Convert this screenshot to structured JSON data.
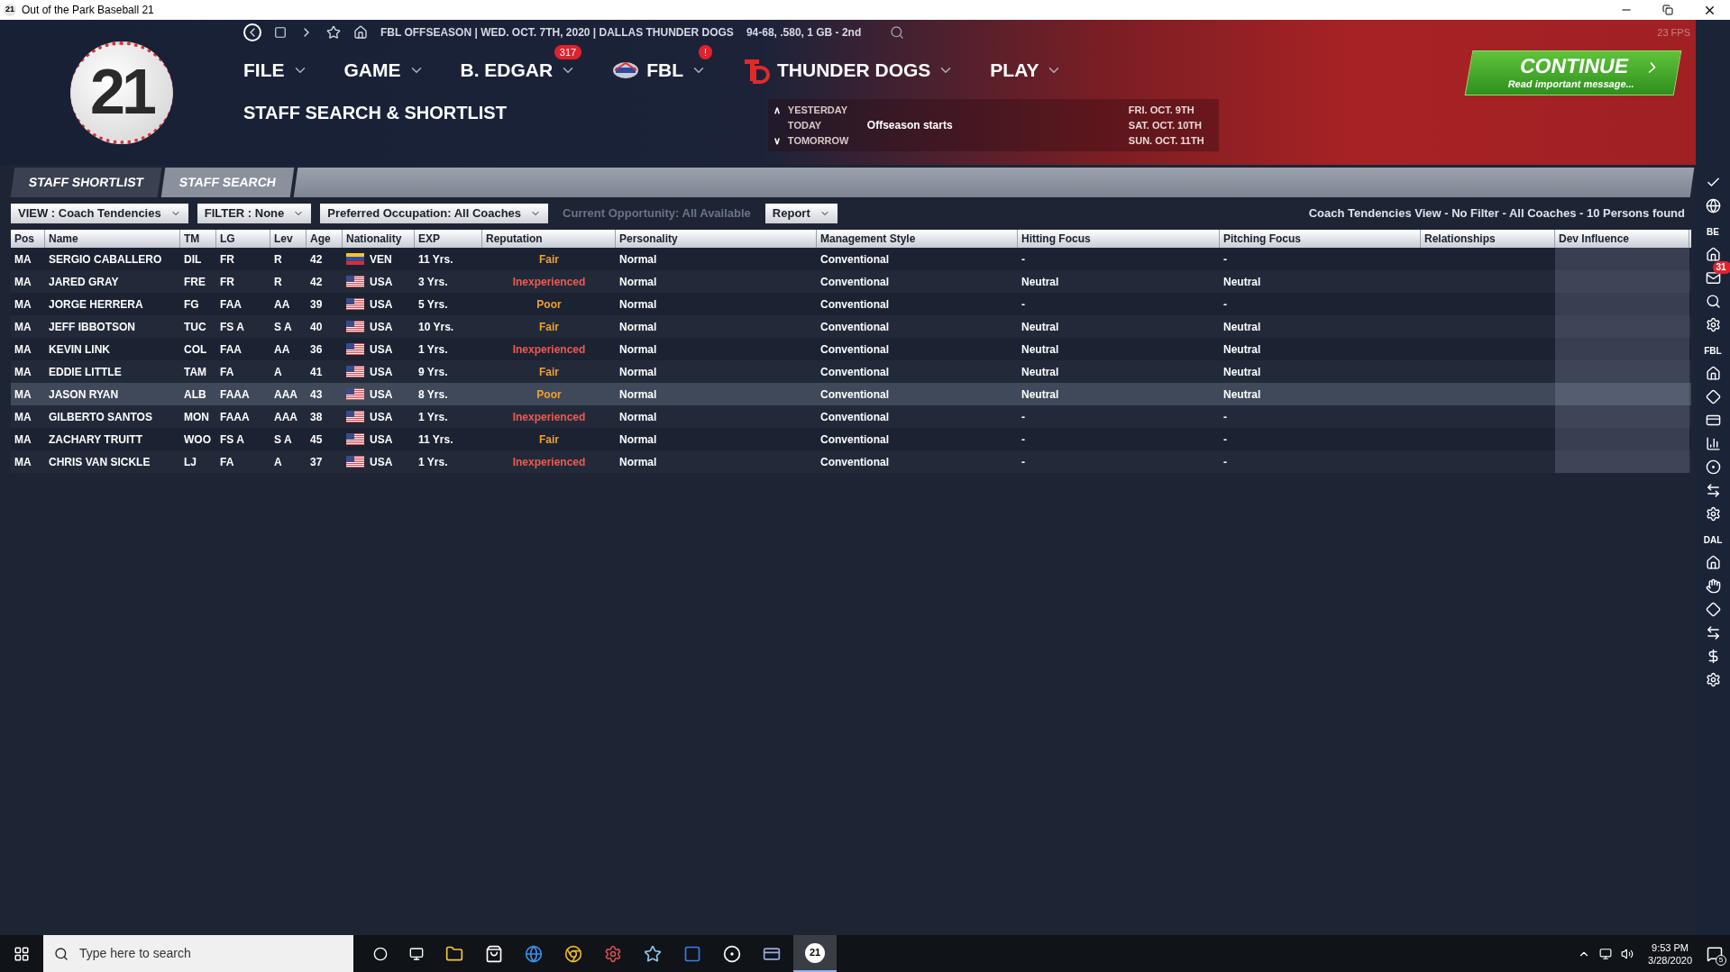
{
  "window": {
    "title": "Out of the Park Baseball 21",
    "app_icon": "21",
    "fps": "23 FPS"
  },
  "logo": {
    "text": "21"
  },
  "status": {
    "text": "FBL OFFSEASON | WED. OCT. 7TH, 2020 | DALLAS THUNDER DOGS",
    "record": "94-68, .580, 1 GB - 2nd"
  },
  "menus": [
    {
      "label": "FILE",
      "kind": "plain"
    },
    {
      "label": "GAME",
      "kind": "plain"
    },
    {
      "label": "B. EDGAR",
      "kind": "plain",
      "badge": "317"
    },
    {
      "label": "FBL",
      "kind": "league",
      "badge": "!"
    },
    {
      "label": "THUNDER DOGS",
      "kind": "team"
    },
    {
      "label": "PLAY",
      "kind": "plain"
    }
  ],
  "page_title": "STAFF SEARCH & SHORTLIST",
  "calendar": {
    "days": [
      {
        "arrow": "∧",
        "label": "YESTERDAY"
      },
      {
        "label": "TODAY",
        "event": "Offseason starts"
      },
      {
        "arrow": "∨",
        "label": "TOMORROW"
      }
    ],
    "upcoming": [
      "FRI. OCT. 9TH",
      "SAT. OCT. 10TH",
      "SUN. OCT. 11TH"
    ]
  },
  "continue": {
    "label": "CONTINUE",
    "sublabel": "Read important message..."
  },
  "tabs": [
    {
      "label": "STAFF SHORTLIST",
      "selected": false
    },
    {
      "label": "STAFF SEARCH",
      "selected": true
    }
  ],
  "toolbar": {
    "dropdowns": [
      {
        "label": "VIEW : Coach Tendencies",
        "disabled": false
      },
      {
        "label": "FILTER : None",
        "disabled": false
      },
      {
        "label": "Preferred Occupation: All Coaches",
        "disabled": false
      },
      {
        "label": "Current Opportunity: All Available",
        "disabled": true
      },
      {
        "label": "Report",
        "disabled": false
      }
    ],
    "summary": "Coach Tendencies View - No Filter - All Coaches - 10 Persons found"
  },
  "table": {
    "columns": [
      "Pos",
      "Name",
      "TM",
      "LG",
      "Lev",
      "Age",
      "Nationality",
      "EXP",
      "Reputation",
      "Personality",
      "Management Style",
      "Hitting Focus",
      "Pitching Focus",
      "Relationships",
      "Dev Influence"
    ],
    "rows": [
      {
        "pos": "MA",
        "name": "SERGIO CABALLERO",
        "tm": "DIL",
        "lg": "FR",
        "lev": "R",
        "age": "42",
        "nationality": {
          "kind": "ven",
          "text": "VEN"
        },
        "exp": "11 Yrs.",
        "reputation": {
          "text": "Fair",
          "color": "#f0a030"
        },
        "personality": "Normal",
        "management": "Conventional",
        "hitting": "-",
        "pitching": "-",
        "selected": false
      },
      {
        "pos": "MA",
        "name": "JARED GRAY",
        "tm": "FRE",
        "lg": "FR",
        "lev": "R",
        "age": "42",
        "nationality": {
          "kind": "usa",
          "text": "USA"
        },
        "exp": "3 Yrs.",
        "reputation": {
          "text": "Inexperienced",
          "color": "#ee5a50"
        },
        "personality": "Normal",
        "management": "Conventional",
        "hitting": "Neutral",
        "pitching": "Neutral",
        "selected": false
      },
      {
        "pos": "MA",
        "name": "JORGE HERRERA",
        "tm": "FG",
        "lg": "FAA",
        "lev": "AA",
        "age": "39",
        "nationality": {
          "kind": "usa",
          "text": "USA"
        },
        "exp": "5 Yrs.",
        "reputation": {
          "text": "Poor",
          "color": "#f0a030"
        },
        "personality": "Normal",
        "management": "Conventional",
        "hitting": "-",
        "pitching": "-",
        "selected": false
      },
      {
        "pos": "MA",
        "name": "JEFF IBBOTSON",
        "tm": "TUC",
        "lg": "FS A",
        "lev": "S A",
        "age": "40",
        "nationality": {
          "kind": "usa",
          "text": "USA"
        },
        "exp": "10 Yrs.",
        "reputation": {
          "text": "Fair",
          "color": "#f0a030"
        },
        "personality": "Normal",
        "management": "Conventional",
        "hitting": "Neutral",
        "pitching": "Neutral",
        "selected": false
      },
      {
        "pos": "MA",
        "name": "KEVIN LINK",
        "tm": "COL",
        "lg": "FAA",
        "lev": "AA",
        "age": "36",
        "nationality": {
          "kind": "usa",
          "text": "USA"
        },
        "exp": "1 Yrs.",
        "reputation": {
          "text": "Inexperienced",
          "color": "#ee5a50"
        },
        "personality": "Normal",
        "management": "Conventional",
        "hitting": "Neutral",
        "pitching": "Neutral",
        "selected": false
      },
      {
        "pos": "MA",
        "name": "EDDIE LITTLE",
        "tm": "TAM",
        "lg": "FA",
        "lev": "A",
        "age": "41",
        "nationality": {
          "kind": "usa",
          "text": "USA"
        },
        "exp": "9 Yrs.",
        "reputation": {
          "text": "Fair",
          "color": "#f0a030"
        },
        "personality": "Normal",
        "management": "Conventional",
        "hitting": "Neutral",
        "pitching": "Neutral",
        "selected": false
      },
      {
        "pos": "MA",
        "name": "JASON RYAN",
        "tm": "ALB",
        "lg": "FAAA",
        "lev": "AAA",
        "age": "43",
        "nationality": {
          "kind": "usa",
          "text": "USA"
        },
        "exp": "8 Yrs.",
        "reputation": {
          "text": "Poor",
          "color": "#f0a030"
        },
        "personality": "Normal",
        "management": "Conventional",
        "hitting": "Neutral",
        "pitching": "Neutral",
        "selected": true
      },
      {
        "pos": "MA",
        "name": "GILBERTO SANTOS",
        "tm": "MON",
        "lg": "FAAA",
        "lev": "AAA",
        "age": "38",
        "nationality": {
          "kind": "usa",
          "text": "USA"
        },
        "exp": "1 Yrs.",
        "reputation": {
          "text": "Inexperienced",
          "color": "#ee5a50"
        },
        "personality": "Normal",
        "management": "Conventional",
        "hitting": "-",
        "pitching": "-",
        "selected": false
      },
      {
        "pos": "MA",
        "name": "ZACHARY TRUITT",
        "tm": "WOO",
        "lg": "FS A",
        "lev": "S A",
        "age": "45",
        "nationality": {
          "kind": "usa",
          "text": "USA"
        },
        "exp": "11 Yrs.",
        "reputation": {
          "text": "Fair",
          "color": "#f0a030"
        },
        "personality": "Normal",
        "management": "Conventional",
        "hitting": "-",
        "pitching": "-",
        "selected": false
      },
      {
        "pos": "MA",
        "name": "CHRIS VAN SICKLE",
        "tm": "LJ",
        "lg": "FA",
        "lev": "A",
        "age": "37",
        "nationality": {
          "kind": "usa",
          "text": "USA"
        },
        "exp": "1 Yrs.",
        "reputation": {
          "text": "Inexperienced",
          "color": "#ee5a50"
        },
        "personality": "Normal",
        "management": "Conventional",
        "hitting": "-",
        "pitching": "-",
        "selected": false
      }
    ]
  },
  "sidebar": {
    "headings": [
      "BE",
      "FBL",
      "DAL"
    ],
    "mail_badge": "31"
  },
  "taskbar": {
    "search_placeholder": "Type here to search",
    "active_app": "21",
    "time": "9:53 PM",
    "date": "3/28/2020",
    "notifications": "5"
  }
}
